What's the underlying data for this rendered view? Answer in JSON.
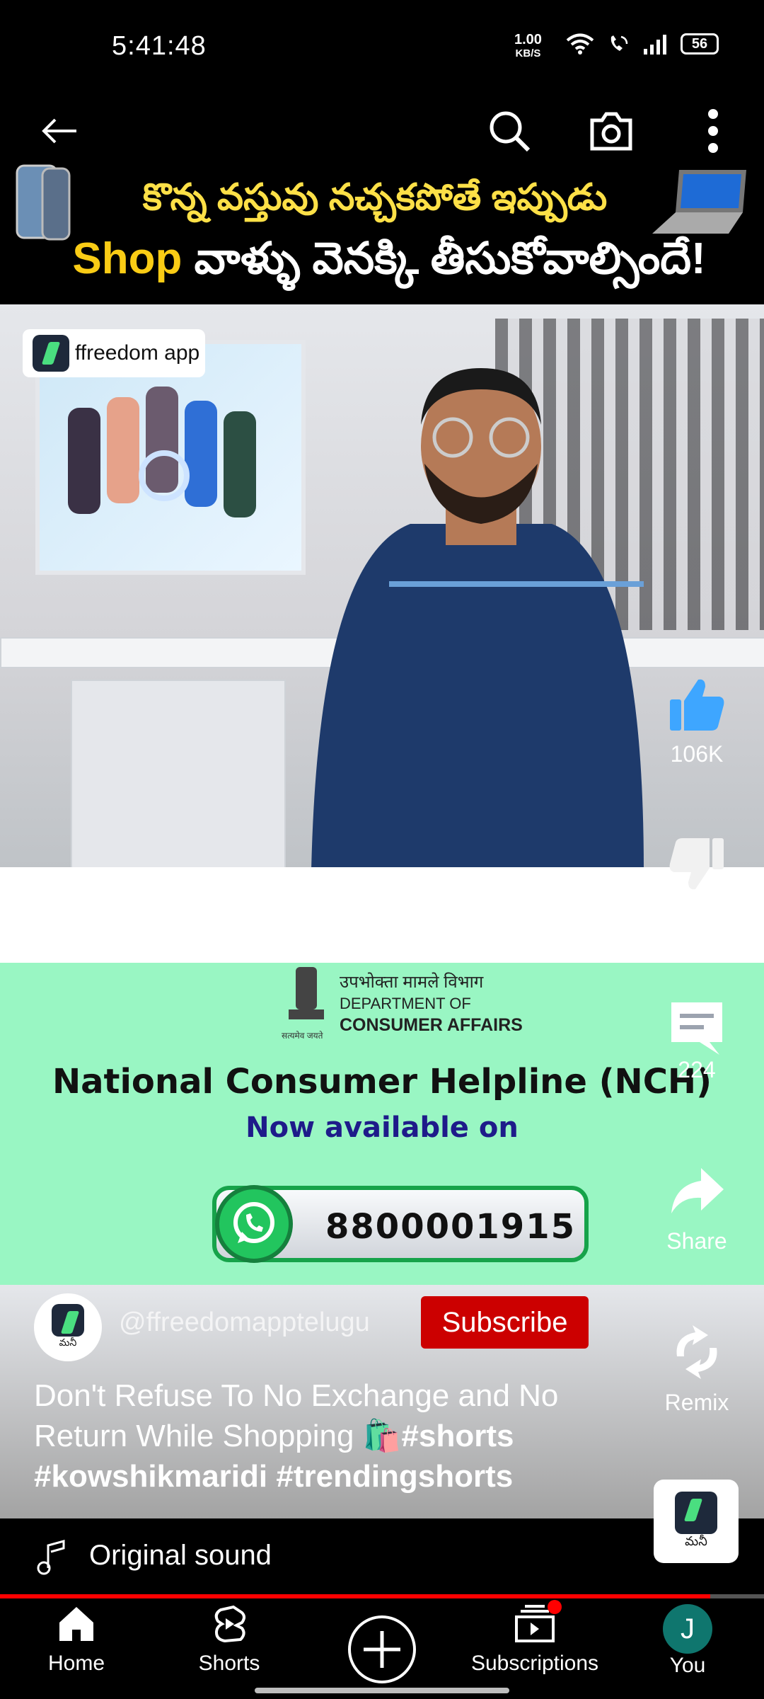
{
  "status_bar": {
    "time": "5:41:48",
    "net_speed_top": "1.00",
    "net_speed_unit": "KB/S",
    "battery": "56"
  },
  "banner": {
    "line1": "కొన్న వస్తువు నచ్చకపోతే ఇప్పుడు",
    "line2_brand": "Shop",
    "line2_rest": " వాళ్ళు వెనక్కి తీసుకోవాల్సిందే!"
  },
  "video": {
    "logo_text": "ffreedom app"
  },
  "ad": {
    "dept_hindi": "उपभोक्ता मामले विभाग",
    "dept_line1": "DEPARTMENT OF",
    "dept_line2": "CONSUMER AFFAIRS",
    "motto": "सत्यमेव जयते",
    "title": "National Consumer Helpline (NCH)",
    "subtitle": "Now available on",
    "whatsapp_number": "8800001915"
  },
  "actions": {
    "like_count": "106K",
    "dislike_label": "Dislike",
    "comment_count": "224",
    "share_label": "Share",
    "remix_label": "Remix"
  },
  "channel": {
    "handle": "@ffreedomapptelugu",
    "subscribe_label": "Subscribe",
    "avatar_caption": "మనీ"
  },
  "caption": {
    "text": "Don't Refuse To No Exchange and No Return While Shopping 🛍️",
    "tags1": "#shorts",
    "tags2": "#kowshikmaridi #trendingshorts"
  },
  "sound": {
    "label": "Original sound",
    "app_caption": "మనీ"
  },
  "progress": {
    "fraction": 0.93
  },
  "nav": {
    "home": "Home",
    "shorts": "Shorts",
    "subscriptions": "Subscriptions",
    "you": "You",
    "you_initial": "J"
  },
  "colors": {
    "accent_red": "#ff0000",
    "subscribe_red": "#cc0000",
    "like_blue": "#3ea6ff",
    "ad_green": "#99f6c3"
  }
}
